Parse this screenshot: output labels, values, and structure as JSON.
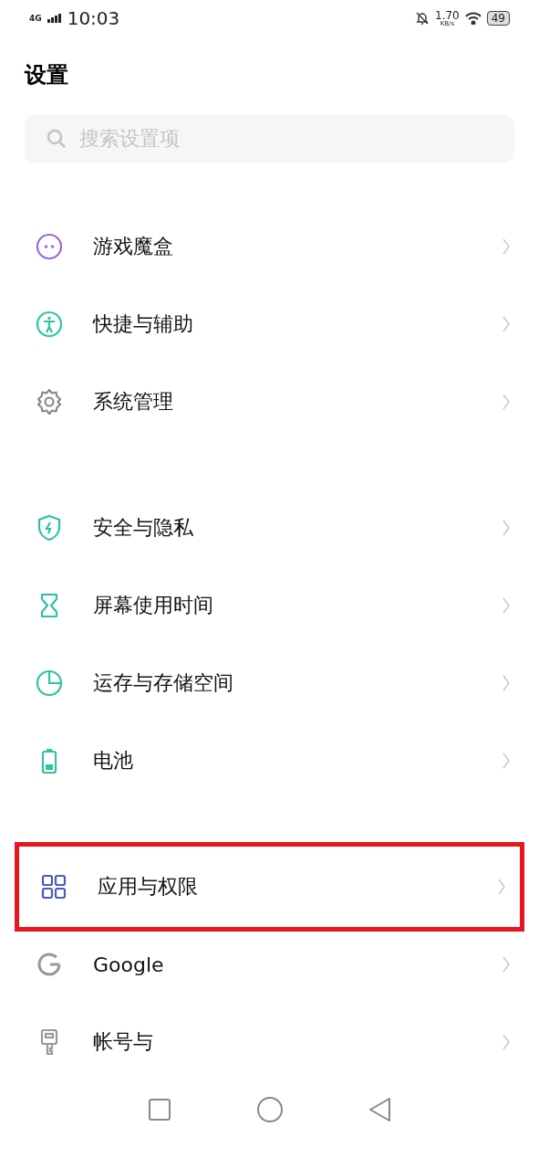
{
  "status_bar": {
    "network": "4G",
    "time": "10:03",
    "speed": "1.70",
    "speed_unit": "KB/s",
    "battery": "49"
  },
  "title": "设置",
  "search": {
    "placeholder": "搜索设置项"
  },
  "groups": [
    {
      "items": [
        {
          "label": "游戏魔盒",
          "highlighted": false
        },
        {
          "label": "快捷与辅助",
          "highlighted": false
        },
        {
          "label": "系统管理",
          "highlighted": false
        }
      ]
    },
    {
      "items": [
        {
          "label": "安全与隐私",
          "highlighted": false
        },
        {
          "label": "屏幕使用时间",
          "highlighted": false
        },
        {
          "label": "运存与存储空间",
          "highlighted": false
        },
        {
          "label": "电池",
          "highlighted": false
        }
      ]
    },
    {
      "items": [
        {
          "label": "应用与权限",
          "highlighted": true
        },
        {
          "label": "Google",
          "highlighted": false
        },
        {
          "label": "帐号与",
          "highlighted": false
        }
      ]
    }
  ]
}
